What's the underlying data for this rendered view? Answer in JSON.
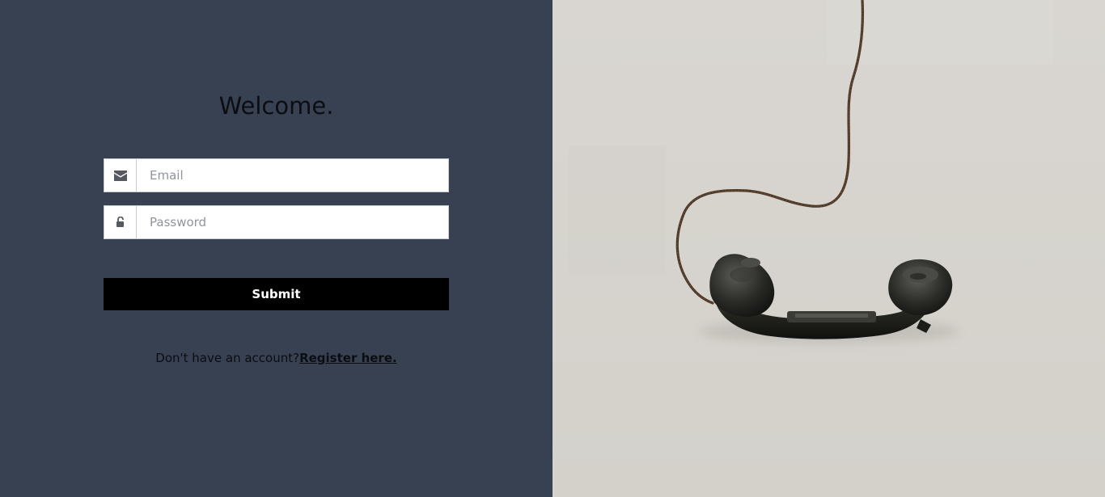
{
  "login": {
    "heading": "Welcome.",
    "email_placeholder": "Email",
    "password_placeholder": "Password",
    "submit_label": "Submit",
    "register_prompt": "Don't have an account?",
    "register_link": "Register here."
  },
  "icons": {
    "email": "envelope-icon",
    "password": "unlock-icon"
  },
  "colors": {
    "left_background": "#384152",
    "right_background": "#d6d3ce",
    "button_background": "#000000",
    "button_text": "#ffffff"
  }
}
